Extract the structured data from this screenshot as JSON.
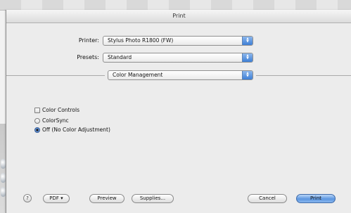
{
  "window": {
    "title": "Print"
  },
  "printer": {
    "label": "Printer:",
    "value": "Stylus Photo R1800 (FW)"
  },
  "presets": {
    "label": "Presets:",
    "value": "Standard"
  },
  "panel": {
    "value": "Color Management"
  },
  "options": {
    "color_controls": "Color Controls",
    "colorsync": "ColorSync",
    "off": "Off (No Color Adjustment)",
    "selected": "off"
  },
  "buttons": {
    "help": "?",
    "pdf": "PDF ▾",
    "preview": "Preview",
    "supplies": "Supplies...",
    "cancel": "Cancel",
    "print": "Print"
  },
  "icons": {
    "popup_arrows": "updown-arrows-icon",
    "help": "help-icon"
  },
  "colors": {
    "accent": "#3d7fd6",
    "default_button": "#5c96e0"
  }
}
